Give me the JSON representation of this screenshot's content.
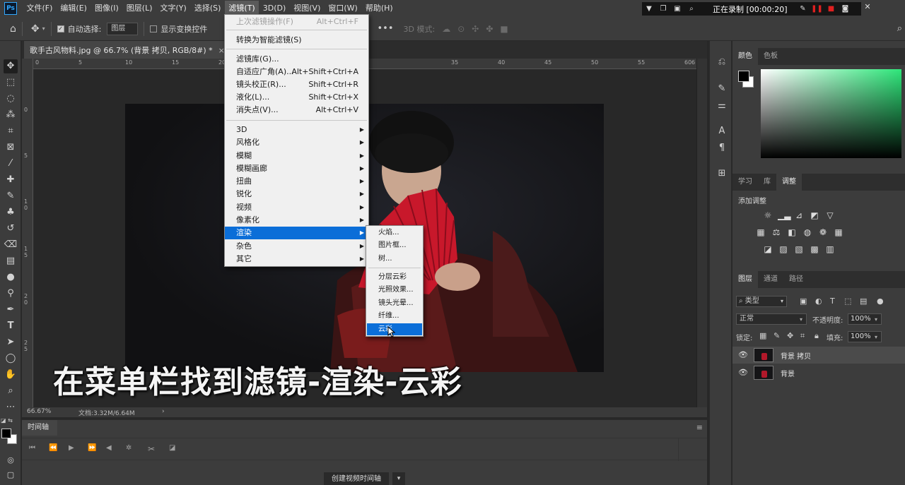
{
  "menubar": {
    "logo": "Ps",
    "items": [
      "文件(F)",
      "编辑(E)",
      "图像(I)",
      "图层(L)",
      "文字(Y)",
      "选择(S)",
      "滤镜(T)",
      "3D(D)",
      "视图(V)",
      "窗口(W)",
      "帮助(H)"
    ],
    "active_index": 6
  },
  "recorder": {
    "status": "正在录制 [00:00:20]"
  },
  "options": {
    "auto_select_label": "自动选择:",
    "layer_select_value": "图层",
    "show_transform_label": "显示变换控件",
    "mode_3d_label": "3D 模式:"
  },
  "document": {
    "tab_title": "歌手古风物料.jpg @ 66.7% (背景 拷贝, RGB/8#) *",
    "close": "×"
  },
  "rulers": {
    "h": [
      "0",
      "5",
      "10",
      "15",
      "20",
      "35",
      "40",
      "45",
      "50",
      "55",
      "60",
      "6"
    ],
    "v": [
      "0",
      "5",
      "1 0",
      "1 5",
      "2 0",
      "2 5"
    ]
  },
  "filter_menu": {
    "items": [
      {
        "label": "上次滤镜操作(F)",
        "shortcut": "Alt+Ctrl+F",
        "disabled": true
      },
      {
        "label": "转换为智能滤镜(S)"
      },
      {
        "label": "滤镜库(G)..."
      },
      {
        "label": "自适应广角(A)...",
        "shortcut": "Alt+Shift+Ctrl+A"
      },
      {
        "label": "镜头校正(R)...",
        "shortcut": "Shift+Ctrl+R"
      },
      {
        "label": "液化(L)...",
        "shortcut": "Shift+Ctrl+X"
      },
      {
        "label": "消失点(V)...",
        "shortcut": "Alt+Ctrl+V"
      },
      {
        "label": "3D",
        "submenu": true
      },
      {
        "label": "风格化",
        "submenu": true
      },
      {
        "label": "模糊",
        "submenu": true
      },
      {
        "label": "模糊画廊",
        "submenu": true
      },
      {
        "label": "扭曲",
        "submenu": true
      },
      {
        "label": "锐化",
        "submenu": true
      },
      {
        "label": "视频",
        "submenu": true
      },
      {
        "label": "像素化",
        "submenu": true
      },
      {
        "label": "渲染",
        "submenu": true,
        "highlight": true
      },
      {
        "label": "杂色",
        "submenu": true
      },
      {
        "label": "其它",
        "submenu": true
      }
    ]
  },
  "render_submenu": {
    "items": [
      "火焰...",
      "图片框...",
      "树...",
      "分层云彩",
      "光照效果...",
      "镜头光晕...",
      "纤维...",
      "云彩"
    ],
    "highlight_index": 7
  },
  "caption": "在菜单栏找到滤镜-渲染-云彩",
  "status": {
    "zoom": "66.67%",
    "doc_size": "文档:3.32M/6.64M"
  },
  "timeline": {
    "tab": "时间轴",
    "create_button": "创建视频时间轴"
  },
  "panels": {
    "color_tabs": [
      "颜色",
      "色板"
    ],
    "adjust_tabs": [
      "学习",
      "库",
      "调整"
    ],
    "adjust_title": "添加调整",
    "layers_tabs": [
      "图层",
      "通道",
      "路径"
    ],
    "filter_kind": "类型",
    "blend_mode": "正常",
    "opacity_label": "不透明度:",
    "opacity_value": "100%",
    "lock_label": "锁定:",
    "fill_label": "填充:",
    "fill_value": "100%",
    "layers": [
      {
        "name": "背景 拷贝",
        "selected": true
      },
      {
        "name": "背景",
        "selected": false
      }
    ]
  },
  "colors": {
    "accent": "#0b6ed8",
    "fan_red": "#c8182b",
    "foreground": "#000000",
    "background": "#ffffff"
  }
}
